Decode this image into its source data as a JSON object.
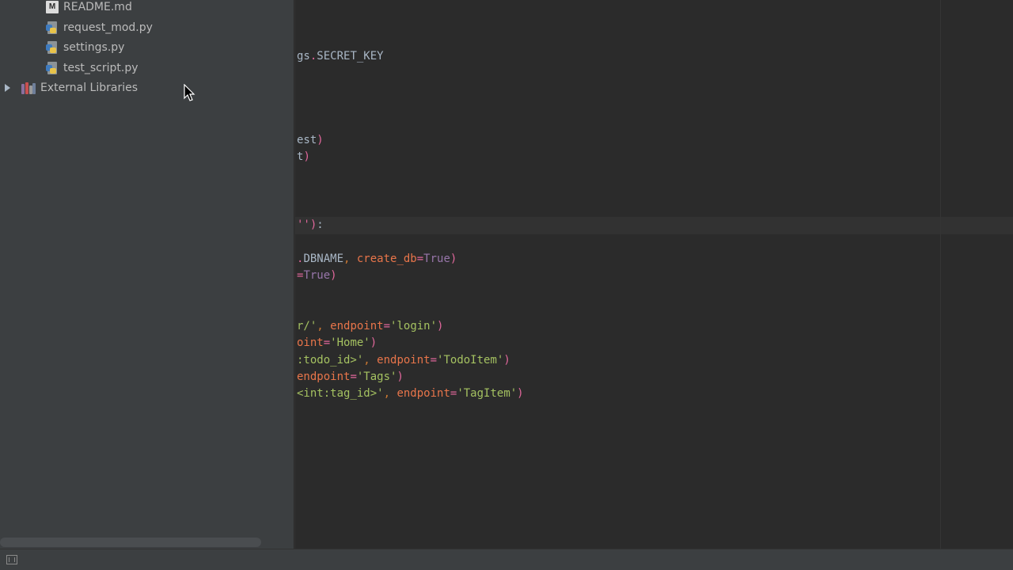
{
  "project_tree": {
    "files": [
      {
        "name": "README.md",
        "icon": "markdown-file-icon",
        "icon_letter": "M"
      },
      {
        "name": "request_mod.py",
        "icon": "python-file-icon"
      },
      {
        "name": "settings.py",
        "icon": "python-file-icon"
      },
      {
        "name": "test_script.py",
        "icon": "python-file-icon"
      }
    ],
    "external_libraries": {
      "label": "External Libraries",
      "icon": "library-icon",
      "expander": "collapsed-arrow-icon"
    }
  },
  "editor": {
    "lines": [
      [
        {
          "t": "gs",
          "c": "plain"
        },
        {
          "t": ".",
          "c": "op"
        },
        {
          "t": "SECRET_KEY",
          "c": "plain"
        }
      ],
      [
        {
          "t": "est",
          "c": "plain"
        },
        {
          "t": ")",
          "c": "paren"
        }
      ],
      [
        {
          "t": "t",
          "c": "plain"
        },
        {
          "t": ")",
          "c": "paren"
        }
      ],
      [
        {
          "t": "'')",
          "c": "paren"
        },
        {
          "t": ":",
          "c": "plain"
        }
      ],
      [
        {
          "t": ".",
          "c": "op"
        },
        {
          "t": "DBNAME",
          "c": "plain"
        },
        {
          "t": ", ",
          "c": "kw"
        },
        {
          "t": "create_db",
          "c": "param"
        },
        {
          "t": "=",
          "c": "op"
        },
        {
          "t": "True",
          "c": "true"
        },
        {
          "t": ")",
          "c": "paren"
        }
      ],
      [
        {
          "t": "=",
          "c": "op"
        },
        {
          "t": "True",
          "c": "true"
        },
        {
          "t": ")",
          "c": "paren"
        }
      ],
      [
        {
          "t": "r/'",
          "c": "str"
        },
        {
          "t": ", ",
          "c": "kw"
        },
        {
          "t": "endpoint",
          "c": "param"
        },
        {
          "t": "=",
          "c": "op"
        },
        {
          "t": "'login'",
          "c": "str"
        },
        {
          "t": ")",
          "c": "paren"
        }
      ],
      [
        {
          "t": "oint",
          "c": "param"
        },
        {
          "t": "=",
          "c": "op"
        },
        {
          "t": "'Home'",
          "c": "str"
        },
        {
          "t": ")",
          "c": "paren"
        }
      ],
      [
        {
          "t": ":todo_id>'",
          "c": "str"
        },
        {
          "t": ", ",
          "c": "kw"
        },
        {
          "t": "endpoint",
          "c": "param"
        },
        {
          "t": "=",
          "c": "op"
        },
        {
          "t": "'TodoItem'",
          "c": "str"
        },
        {
          "t": ")",
          "c": "paren"
        }
      ],
      [
        {
          "t": "endpoint",
          "c": "param"
        },
        {
          "t": "=",
          "c": "op"
        },
        {
          "t": "'Tags'",
          "c": "str"
        },
        {
          "t": ")",
          "c": "paren"
        }
      ],
      [
        {
          "t": "<int:tag_id>'",
          "c": "str"
        },
        {
          "t": ", ",
          "c": "kw"
        },
        {
          "t": "endpoint",
          "c": "param"
        },
        {
          "t": "=",
          "c": "op"
        },
        {
          "t": "'TagItem'",
          "c": "str"
        },
        {
          "t": ")",
          "c": "paren"
        }
      ]
    ]
  },
  "status_bar": {
    "icon": "tool-window-toggle-icon"
  },
  "colors": {
    "background": "#2b2b2b",
    "sidebar": "#3c3f41",
    "string": "#a5c261",
    "param": "#e8754a",
    "paren": "#e0679b",
    "true": "#9876aa"
  }
}
